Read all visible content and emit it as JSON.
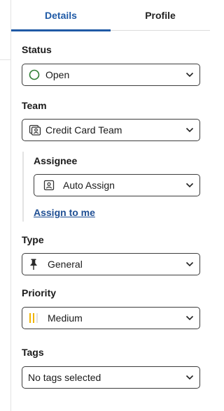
{
  "tabs": [
    {
      "label": "Details",
      "active": true
    },
    {
      "label": "Profile",
      "active": false
    }
  ],
  "fields": {
    "status": {
      "label": "Status",
      "value": "Open",
      "icon": "circle-outline-icon",
      "icon_color": "#2e7d32"
    },
    "team": {
      "label": "Team",
      "value": "Credit Card Team",
      "icon": "team-card-icon"
    },
    "assignee": {
      "label": "Assignee",
      "value": "Auto Assign",
      "icon": "person-card-icon"
    },
    "assign_to_me": "Assign to me",
    "type": {
      "label": "Type",
      "value": "General",
      "icon": "pin-icon"
    },
    "priority": {
      "label": "Priority",
      "value": "Medium",
      "icon": "priority-bars-icon",
      "icon_color": "#f0b400"
    },
    "tags": {
      "label": "Tags",
      "value": "No tags selected"
    }
  },
  "colors": {
    "accent": "#1f5aa6",
    "link": "#1f4f94",
    "border": "#3c3c3c"
  }
}
